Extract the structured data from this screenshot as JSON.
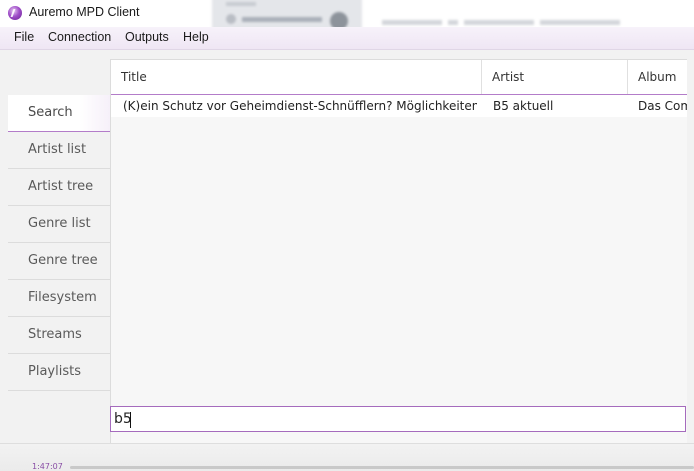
{
  "window": {
    "title": "Auremo MPD Client"
  },
  "menu": [
    "File",
    "Connection",
    "Outputs",
    "Help"
  ],
  "sidebar": {
    "items": [
      {
        "label": "Search",
        "active": true
      },
      {
        "label": "Artist list",
        "active": false
      },
      {
        "label": "Artist tree",
        "active": false
      },
      {
        "label": "Genre list",
        "active": false
      },
      {
        "label": "Genre tree",
        "active": false
      },
      {
        "label": "Filesystem",
        "active": false
      },
      {
        "label": "Streams",
        "active": false
      },
      {
        "label": "Playlists",
        "active": false
      }
    ]
  },
  "results": {
    "columns": [
      "Title",
      "Artist",
      "Album"
    ],
    "rows": [
      [
        "(K)ein Schutz vor Geheimdienst-Schnüfflern? Möglichkeiten und Gr",
        "B5 aktuell",
        "Das Com"
      ]
    ]
  },
  "search": {
    "value": "b5"
  },
  "playback": {
    "time": "1:47:07"
  },
  "colors": {
    "accent": "#a56bbd",
    "menu_bg": "#f3ecf7"
  },
  "icons": {
    "app": "auremo-logo-icon"
  }
}
